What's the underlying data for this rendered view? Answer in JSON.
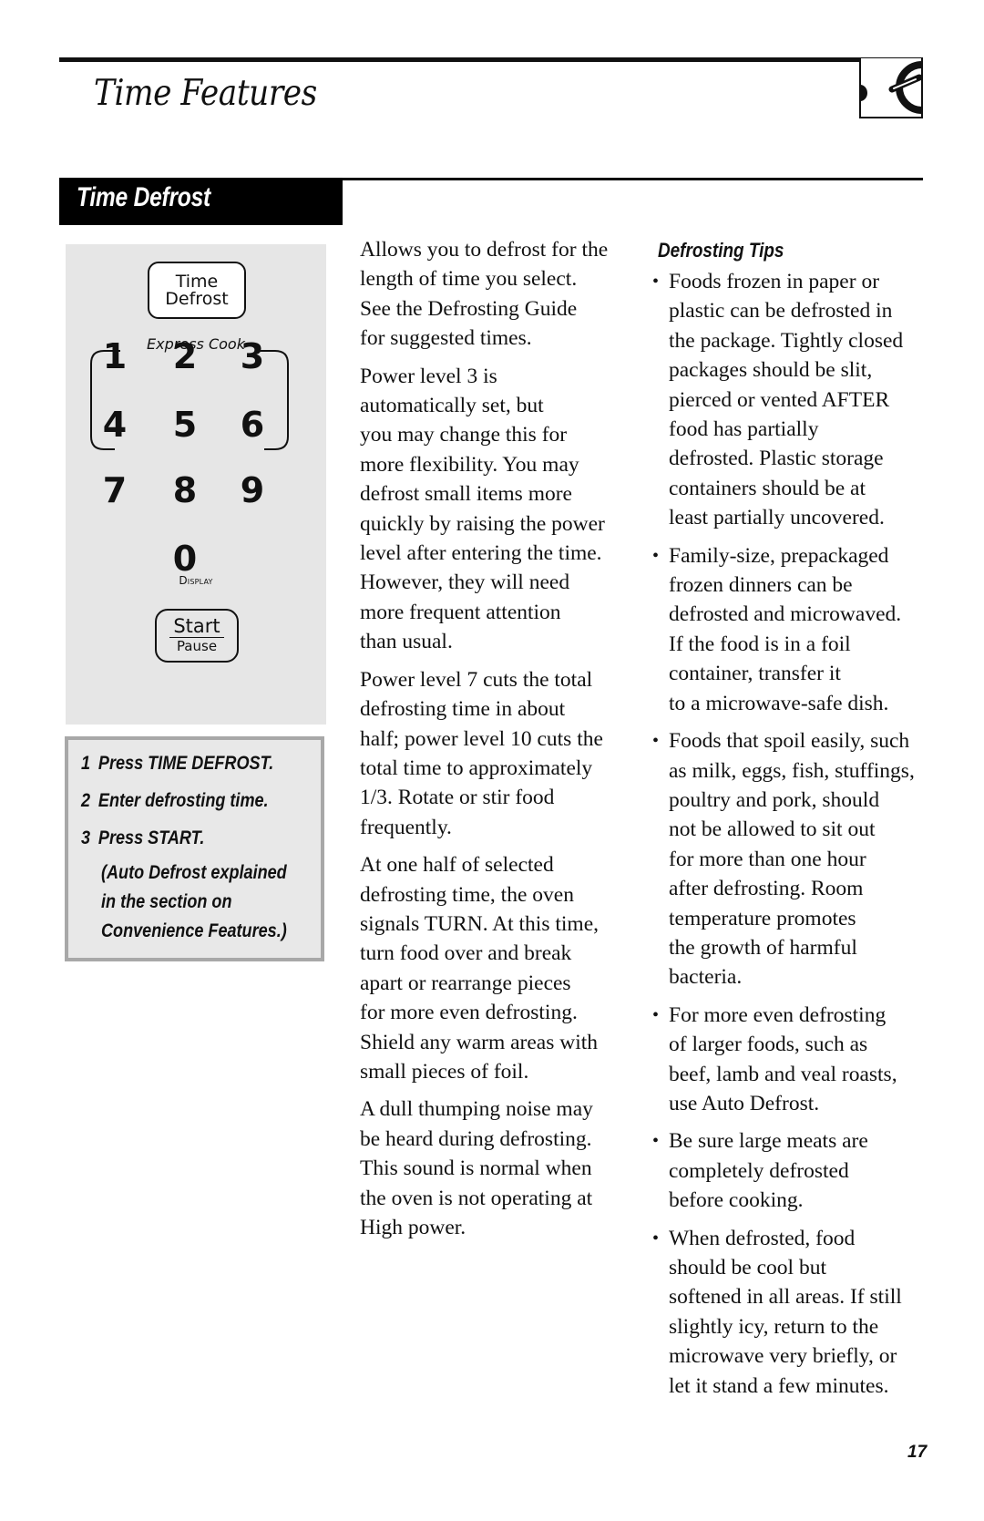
{
  "header": {
    "title": "Time Features",
    "chapter_icon": "microwave-dial-icon"
  },
  "section": {
    "title": "Time Defrost"
  },
  "keypad": {
    "time_defrost_button": [
      "Time",
      "Defrost"
    ],
    "express_cook_label": "Express Cook",
    "digits": [
      "1",
      "2",
      "3",
      "4",
      "5",
      "6",
      "7",
      "8",
      "9",
      "0"
    ],
    "display_label": "Display",
    "start_label": "Start",
    "pause_label": "Pause"
  },
  "steps": [
    {
      "num": "1",
      "text": "Press TIME DEFROST."
    },
    {
      "num": "2",
      "text": "Enter defrosting time."
    },
    {
      "num": "3",
      "text": "Press START."
    }
  ],
  "steps_note": [
    "(Auto Defrost explained",
    "in the section on",
    "Convenience Features.)"
  ],
  "body_paragraphs": [
    [
      "Allows you to defrost for the",
      "length of time you select.",
      "See the Defrosting Guide",
      "for suggested times."
    ],
    [
      "Power level 3 is",
      "automatically set, but",
      "you may change this for",
      "more flexibility. You may",
      "defrost small items more",
      "quickly by raising the power",
      "level after entering the time.",
      "However, they will need",
      "more frequent attention",
      "than usual."
    ],
    [
      "Power level 7 cuts the total",
      "defrosting time in about",
      "half; power level 10 cuts the",
      "total time to approximately",
      "1/3. Rotate or stir food",
      "frequently."
    ],
    [
      "At one half of selected",
      "defrosting time, the oven",
      "signals TURN. At this time,",
      "turn food over and break",
      "apart or rearrange pieces",
      "for more even defrosting.",
      "Shield any warm areas with",
      "small pieces of foil."
    ],
    [
      "A dull thumping noise may",
      "be heard during defrosting.",
      "This sound is normal when",
      "the oven is not operating at",
      "High power."
    ]
  ],
  "tips": {
    "heading": "Defrosting Tips",
    "bullet_glyph": "•",
    "items": [
      [
        "Foods frozen in paper or",
        "plastic can be defrosted in",
        "the package. Tightly closed",
        "packages should be slit,",
        "pierced or vented AFTER",
        "food has partially",
        "defrosted. Plastic storage",
        "containers should be at",
        "least partially uncovered."
      ],
      [
        "Family-size, prepackaged",
        "frozen dinners can be",
        "defrosted and microwaved.",
        "If the food is in a foil",
        "container, transfer it",
        "to a microwave-safe dish."
      ],
      [
        "Foods that spoil easily, such",
        "as milk, eggs, fish, stuffings,",
        "poultry and pork, should",
        "not be allowed to sit out",
        "for more than one hour",
        "after defrosting. Room",
        "temperature promotes",
        "the growth of harmful",
        "bacteria."
      ],
      [
        "For more even defrosting",
        "of larger foods, such as",
        "beef, lamb and veal roasts,",
        "use Auto Defrost."
      ],
      [
        "Be sure large meats are",
        "completely defrosted",
        "before cooking."
      ],
      [
        "When defrosted, food",
        "should be cool but",
        "softened in all areas. If still",
        "slightly icy, return to the",
        "microwave very briefly, or",
        "let it stand a few minutes."
      ]
    ]
  },
  "footer": {
    "page_number": "17"
  }
}
